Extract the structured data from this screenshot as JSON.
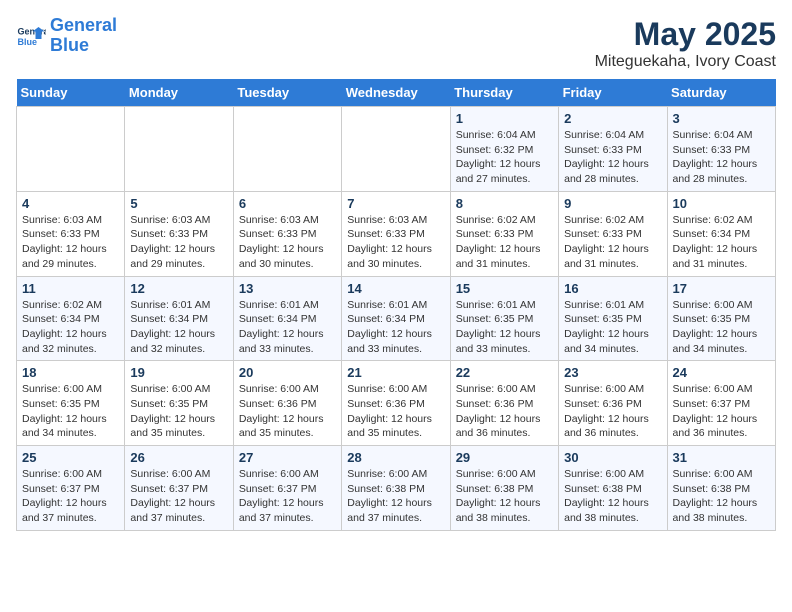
{
  "logo": {
    "line1": "General",
    "line2": "Blue"
  },
  "title": "May 2025",
  "subtitle": "Miteguekaha, Ivory Coast",
  "days_of_week": [
    "Sunday",
    "Monday",
    "Tuesday",
    "Wednesday",
    "Thursday",
    "Friday",
    "Saturday"
  ],
  "weeks": [
    [
      {
        "day": "",
        "detail": ""
      },
      {
        "day": "",
        "detail": ""
      },
      {
        "day": "",
        "detail": ""
      },
      {
        "day": "",
        "detail": ""
      },
      {
        "day": "1",
        "detail": "Sunrise: 6:04 AM\nSunset: 6:32 PM\nDaylight: 12 hours and 27 minutes."
      },
      {
        "day": "2",
        "detail": "Sunrise: 6:04 AM\nSunset: 6:33 PM\nDaylight: 12 hours and 28 minutes."
      },
      {
        "day": "3",
        "detail": "Sunrise: 6:04 AM\nSunset: 6:33 PM\nDaylight: 12 hours and 28 minutes."
      }
    ],
    [
      {
        "day": "4",
        "detail": "Sunrise: 6:03 AM\nSunset: 6:33 PM\nDaylight: 12 hours and 29 minutes."
      },
      {
        "day": "5",
        "detail": "Sunrise: 6:03 AM\nSunset: 6:33 PM\nDaylight: 12 hours and 29 minutes."
      },
      {
        "day": "6",
        "detail": "Sunrise: 6:03 AM\nSunset: 6:33 PM\nDaylight: 12 hours and 30 minutes."
      },
      {
        "day": "7",
        "detail": "Sunrise: 6:03 AM\nSunset: 6:33 PM\nDaylight: 12 hours and 30 minutes."
      },
      {
        "day": "8",
        "detail": "Sunrise: 6:02 AM\nSunset: 6:33 PM\nDaylight: 12 hours and 31 minutes."
      },
      {
        "day": "9",
        "detail": "Sunrise: 6:02 AM\nSunset: 6:33 PM\nDaylight: 12 hours and 31 minutes."
      },
      {
        "day": "10",
        "detail": "Sunrise: 6:02 AM\nSunset: 6:34 PM\nDaylight: 12 hours and 31 minutes."
      }
    ],
    [
      {
        "day": "11",
        "detail": "Sunrise: 6:02 AM\nSunset: 6:34 PM\nDaylight: 12 hours and 32 minutes."
      },
      {
        "day": "12",
        "detail": "Sunrise: 6:01 AM\nSunset: 6:34 PM\nDaylight: 12 hours and 32 minutes."
      },
      {
        "day": "13",
        "detail": "Sunrise: 6:01 AM\nSunset: 6:34 PM\nDaylight: 12 hours and 33 minutes."
      },
      {
        "day": "14",
        "detail": "Sunrise: 6:01 AM\nSunset: 6:34 PM\nDaylight: 12 hours and 33 minutes."
      },
      {
        "day": "15",
        "detail": "Sunrise: 6:01 AM\nSunset: 6:35 PM\nDaylight: 12 hours and 33 minutes."
      },
      {
        "day": "16",
        "detail": "Sunrise: 6:01 AM\nSunset: 6:35 PM\nDaylight: 12 hours and 34 minutes."
      },
      {
        "day": "17",
        "detail": "Sunrise: 6:00 AM\nSunset: 6:35 PM\nDaylight: 12 hours and 34 minutes."
      }
    ],
    [
      {
        "day": "18",
        "detail": "Sunrise: 6:00 AM\nSunset: 6:35 PM\nDaylight: 12 hours and 34 minutes."
      },
      {
        "day": "19",
        "detail": "Sunrise: 6:00 AM\nSunset: 6:35 PM\nDaylight: 12 hours and 35 minutes."
      },
      {
        "day": "20",
        "detail": "Sunrise: 6:00 AM\nSunset: 6:36 PM\nDaylight: 12 hours and 35 minutes."
      },
      {
        "day": "21",
        "detail": "Sunrise: 6:00 AM\nSunset: 6:36 PM\nDaylight: 12 hours and 35 minutes."
      },
      {
        "day": "22",
        "detail": "Sunrise: 6:00 AM\nSunset: 6:36 PM\nDaylight: 12 hours and 36 minutes."
      },
      {
        "day": "23",
        "detail": "Sunrise: 6:00 AM\nSunset: 6:36 PM\nDaylight: 12 hours and 36 minutes."
      },
      {
        "day": "24",
        "detail": "Sunrise: 6:00 AM\nSunset: 6:37 PM\nDaylight: 12 hours and 36 minutes."
      }
    ],
    [
      {
        "day": "25",
        "detail": "Sunrise: 6:00 AM\nSunset: 6:37 PM\nDaylight: 12 hours and 37 minutes."
      },
      {
        "day": "26",
        "detail": "Sunrise: 6:00 AM\nSunset: 6:37 PM\nDaylight: 12 hours and 37 minutes."
      },
      {
        "day": "27",
        "detail": "Sunrise: 6:00 AM\nSunset: 6:37 PM\nDaylight: 12 hours and 37 minutes."
      },
      {
        "day": "28",
        "detail": "Sunrise: 6:00 AM\nSunset: 6:38 PM\nDaylight: 12 hours and 37 minutes."
      },
      {
        "day": "29",
        "detail": "Sunrise: 6:00 AM\nSunset: 6:38 PM\nDaylight: 12 hours and 38 minutes."
      },
      {
        "day": "30",
        "detail": "Sunrise: 6:00 AM\nSunset: 6:38 PM\nDaylight: 12 hours and 38 minutes."
      },
      {
        "day": "31",
        "detail": "Sunrise: 6:00 AM\nSunset: 6:38 PM\nDaylight: 12 hours and 38 minutes."
      }
    ]
  ]
}
